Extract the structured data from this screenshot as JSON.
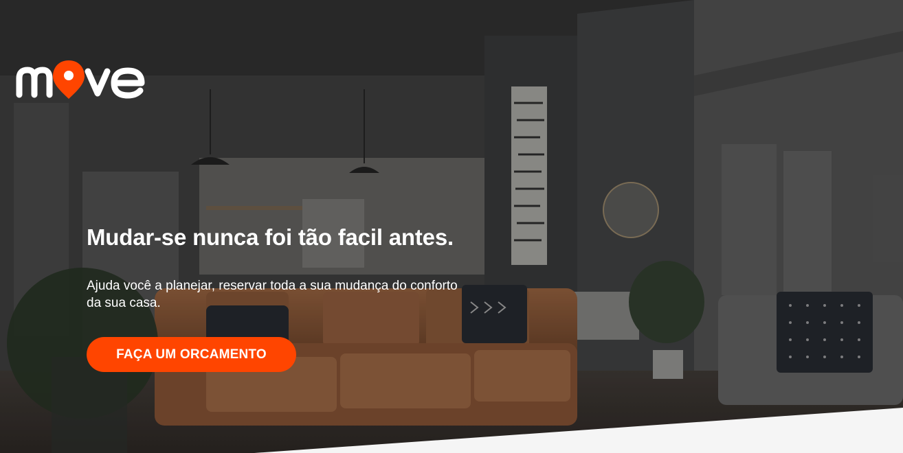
{
  "brand": {
    "name": "move",
    "accent_color": "#ff4500"
  },
  "hero": {
    "headline": "Mudar-se nunca foi tão facil antes.",
    "subtitle": "Ajuda você a planejar, reservar toda a sua mudança do conforto da sua casa.",
    "cta_label": "FAÇA UM ORCAMENTO",
    "background": "living-room-photo"
  },
  "icons": [
    "location-pin-icon"
  ]
}
